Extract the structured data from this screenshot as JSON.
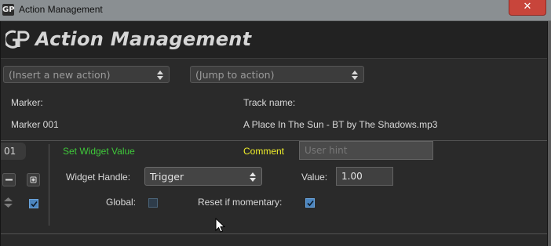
{
  "window": {
    "title": "Action Management",
    "close_glyph": "✕"
  },
  "header": {
    "logo_text": "Action Management"
  },
  "toolbar": {
    "insert_action": "(Insert a new action)",
    "jump_action": "(Jump to action)"
  },
  "info": {
    "marker_label": "Marker:",
    "marker_value": "Marker 001",
    "track_label": "Track name:",
    "track_value": "A Place In The Sun - BT by The Shadows.mp3"
  },
  "action": {
    "number": "01",
    "type": "Set Widget Value",
    "comment_label": "Comment",
    "comment_placeholder": "User hint",
    "widget_handle_label": "Widget Handle:",
    "widget_handle_value": "Trigger",
    "value_label": "Value:",
    "value": "1.00",
    "global_label": "Global:",
    "global_checked": false,
    "reset_label": "Reset if momentary:",
    "reset_checked": true,
    "enabled_checked": true
  },
  "colors": {
    "action_type": "#3fc83a",
    "comment": "#f0ee2a",
    "close": "#c8453b"
  },
  "icons": [
    "app-logo-icon",
    "close-icon",
    "remove-icon",
    "add-icon",
    "reorder-icon",
    "updown-arrows-icon",
    "check-icon",
    "mouse-cursor-icon"
  ]
}
